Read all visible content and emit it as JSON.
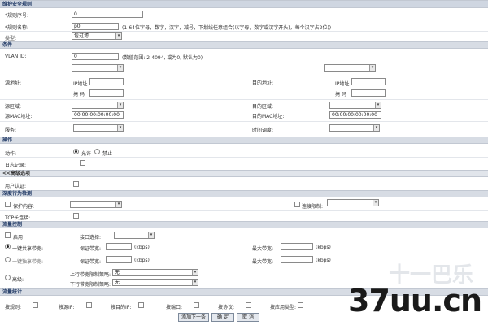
{
  "title": "维护安全规则",
  "rule": {
    "id_label": "*规则序号:",
    "id_value": "0",
    "name_label": "*规则名称:",
    "name_value": "p0",
    "name_hint": "(1-64位字母，数字，汉字，减号，下划线任意组合(以字母，数字或汉字开头)，每个汉字占2位))",
    "type_label": "类型:",
    "type_value": "包过滤"
  },
  "conditions": {
    "section": "条件",
    "vlan_label": "VLAN ID:",
    "vlan_value": "0",
    "vlan_hint": "(数值范围: 2-4094, 或为0, 默认为0)",
    "src_addr_label": "源地址:",
    "dst_addr_label": "目的地址:",
    "ip_label": "IP地址",
    "mask_label": "掩  码",
    "src_zone_label": "源区域:",
    "dst_zone_label": "目的区域:",
    "src_mac_label": "源MAC地址:",
    "src_mac_value": "00:00:00:00:00:00",
    "dst_mac_label": "目的MAC地址:",
    "dst_mac_value": "00:00:00:00:00:00",
    "service_label": "服务:",
    "schedule_label": "时间调度:"
  },
  "operation": {
    "section": "操作",
    "action_label": "动作:",
    "allow": "允许",
    "deny": "禁止",
    "log_label": "日志记录:"
  },
  "advanced": {
    "section": "<<高级选项",
    "auth_label": "用户认证:"
  },
  "deep": {
    "section": "深度行为检测",
    "protect_label": "保护内容:",
    "conn_label": "连接限制:",
    "tcp_label": "TCP长连接:"
  },
  "traffic": {
    "section": "流量控制",
    "enable_label": "启用",
    "iface_label": "接口选择:",
    "shared_label": "一键共享带宽:",
    "exclusive_label": "一键独享带宽:",
    "guarantee_label": "保证带宽:",
    "max_label": "最大带宽:",
    "unit": "(kbps)",
    "advanced_label": "高级:",
    "up_label": "上行带宽限制策略:",
    "down_label": "下行带宽限制策略:",
    "none": "无"
  },
  "stats": {
    "section": "流量统计",
    "items": [
      "按规则:",
      "按源IP:",
      "按目的IP:",
      "按端口:",
      "按协议:",
      "按应用类型:"
    ]
  },
  "buttons": {
    "add_next": "添加下一条",
    "ok": "确 定",
    "cancel": "取 消"
  },
  "watermark": "37uu.cn",
  "watermark_faint": "十一巴乐"
}
